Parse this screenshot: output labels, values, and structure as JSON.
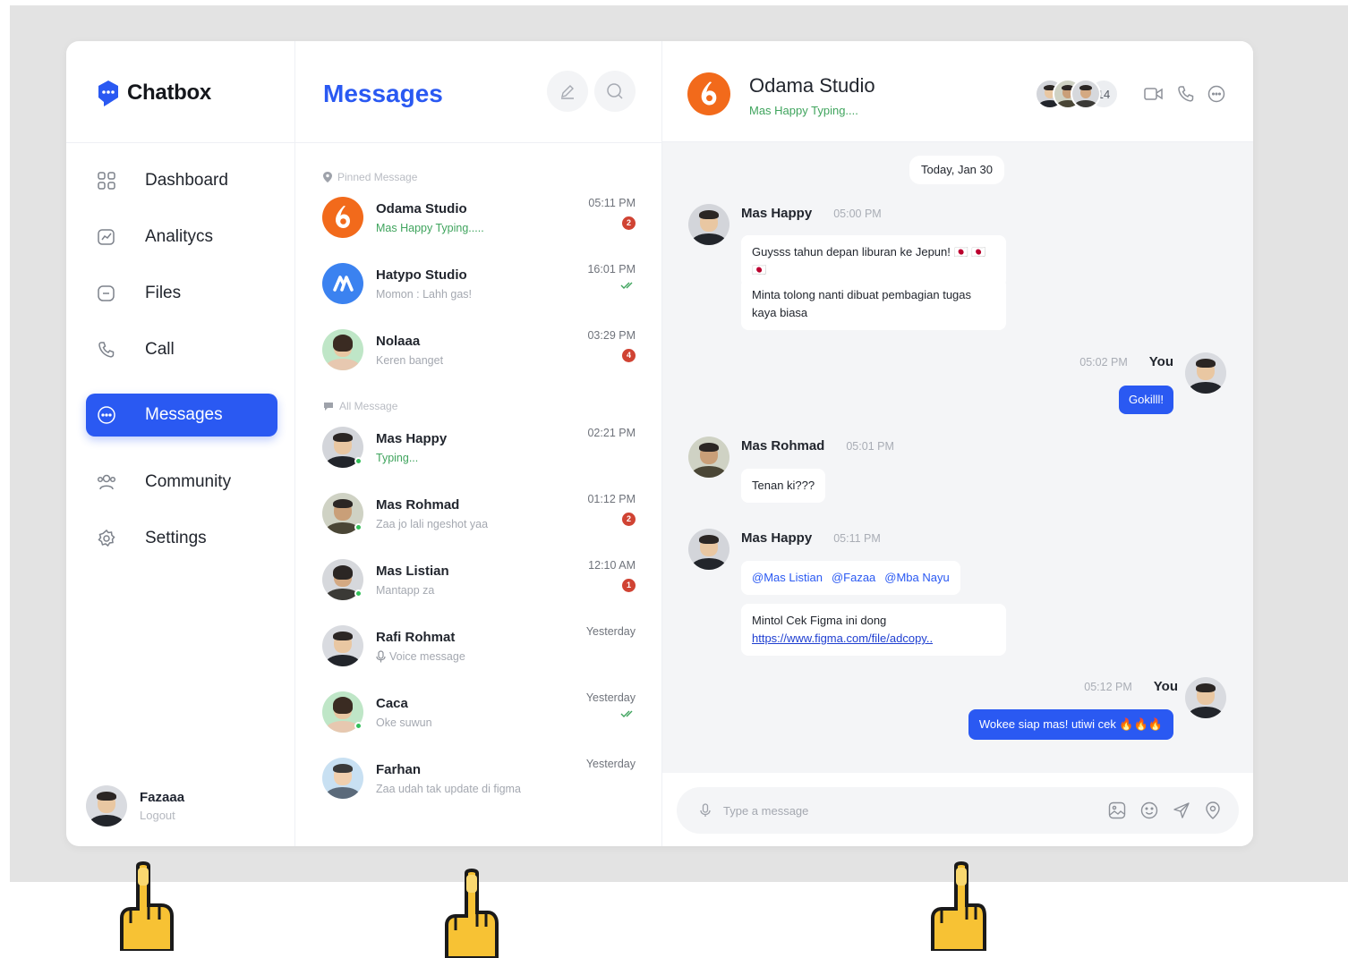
{
  "brand": {
    "name": "Chatbox",
    "accent": "#2a59f2"
  },
  "sidebar": {
    "items": [
      {
        "label": "Dashboard",
        "icon": "grid-icon"
      },
      {
        "label": "Analitycs",
        "icon": "chart-icon"
      },
      {
        "label": "Files",
        "icon": "folder-icon"
      },
      {
        "label": "Call",
        "icon": "phone-icon"
      },
      {
        "label": "Messages",
        "icon": "chat-bubble-icon",
        "active": true
      },
      {
        "label": "Community",
        "icon": "users-icon"
      },
      {
        "label": "Settings",
        "icon": "gear-icon"
      }
    ],
    "user": {
      "name": "Fazaaa",
      "action": "Logout"
    }
  },
  "messages_panel": {
    "title": "Messages",
    "pinned_label": "Pinned Message",
    "all_label": "All Message",
    "conversations": [
      {
        "name": "Odama Studio",
        "preview": "Mas Happy Typing.....",
        "time": "05:11 PM",
        "unread": "2"
      },
      {
        "name": "Hatypo Studio",
        "preview": "Momon : Lahh gas!",
        "time": "16:01 PM",
        "read": true
      },
      {
        "name": "Nolaaa",
        "preview": "Keren banget",
        "time": "03:29 PM",
        "unread": "4"
      },
      {
        "name": "Mas Happy",
        "preview": "Typing...",
        "time": "02:21 PM"
      },
      {
        "name": "Mas Rohmad",
        "preview": "Zaa jo lali ngeshot yaa",
        "time": "01:12 PM",
        "unread": "2"
      },
      {
        "name": "Mas Listian",
        "preview": "Mantapp za",
        "time": "12:10 AM",
        "unread": "1"
      },
      {
        "name": "Rafi Rohmat",
        "preview": "Voice message",
        "time": "Yesterday"
      },
      {
        "name": "Caca",
        "preview": "Oke suwun",
        "time": "Yesterday",
        "read": true
      },
      {
        "name": "Farhan",
        "preview": "Zaa udah tak update di figma",
        "time": "Yesterday"
      }
    ]
  },
  "chat": {
    "title": "Odama Studio",
    "status": "Mas Happy Typing....",
    "member_count": "14",
    "date_divider": "Today, Jan 30",
    "messages": [
      {
        "author": "Mas Happy",
        "time": "05:00 PM",
        "lines": [
          "Guysss tahun depan liburan ke Jepun! 🇯🇵 🇯🇵 🇯🇵",
          "Minta tolong nanti dibuat pembagian tugas kaya biasa"
        ]
      },
      {
        "author": "You",
        "time": "05:02 PM",
        "text": "Gokilll!"
      },
      {
        "author": "Mas Rohmad",
        "time": "05:01 PM",
        "text": "Tenan ki???"
      },
      {
        "author": "Mas Happy",
        "time": "05:11 PM",
        "mentions": [
          "@Mas Listian",
          "@Fazaa",
          "@Mba Nayu"
        ],
        "text": "Mintol Cek Figma ini dong",
        "link": "https://www.figma.com/file/adcopy.."
      },
      {
        "author": "You",
        "time": "05:12 PM",
        "text": "Wokee siap mas! utiwi cek 🔥🔥🔥"
      }
    ],
    "input_placeholder": "Type a message"
  }
}
